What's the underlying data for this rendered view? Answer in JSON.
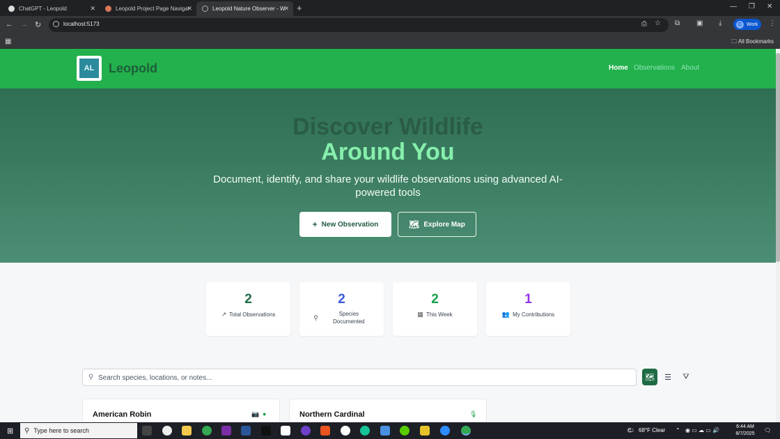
{
  "browser": {
    "tabs": [
      {
        "title": "ChatGPT - Leopold",
        "icon": "chatgpt-icon",
        "active": false
      },
      {
        "title": "Leopold Project Page Navigati",
        "icon": "claude-icon",
        "active": false
      },
      {
        "title": "Leopold Nature Observer - Wil",
        "icon": "globe-icon",
        "active": true
      }
    ],
    "url": "localhost:5173",
    "profile_initial": "C",
    "profile_label": "Work",
    "bookmarks_label": "All Bookmarks"
  },
  "header": {
    "logo_text": "AL",
    "brand": "Leopold",
    "nav": [
      {
        "label": "Home",
        "active": true
      },
      {
        "label": "Observations",
        "active": false
      },
      {
        "label": "About",
        "active": false
      }
    ]
  },
  "hero": {
    "title_line1": "Discover Wildlife",
    "title_line2": "Around You",
    "subtitle": "Document, identify, and share your wildlife observations using advanced AI-powered tools",
    "primary_button": "New Observation",
    "secondary_button": "Explore Map"
  },
  "stats": [
    {
      "value": "2",
      "label": "Total Observations",
      "icon": "trending-up-icon",
      "color": "#1f6b45"
    },
    {
      "value": "2",
      "label": "Species Documented",
      "icon": "search-icon",
      "color": "#3b5bdb"
    },
    {
      "value": "2",
      "label": "This Week",
      "icon": "calendar-icon",
      "color": "#16a34a"
    },
    {
      "value": "1",
      "label": "My Contributions",
      "icon": "users-icon",
      "color": "#9333ea"
    }
  ],
  "search": {
    "placeholder": "Search species, locations, or notes..."
  },
  "view_controls": [
    "grid-view",
    "list-view",
    "filter"
  ],
  "observations": [
    {
      "name": "American Robin",
      "icons": [
        "camera-icon",
        "verified-icon"
      ]
    },
    {
      "name": "Northern Cardinal",
      "icons": [
        "microphone-icon"
      ]
    }
  ],
  "taskbar": {
    "search_placeholder": "Type here to search",
    "weather": "68°F  Clear",
    "time": "6:44 AM",
    "date": "8/7/2025"
  },
  "colors": {
    "header_green": "#22b14c",
    "hero_start": "#2e6e52",
    "hero_end": "#4c8e74",
    "accent_light_green": "#86efac"
  }
}
